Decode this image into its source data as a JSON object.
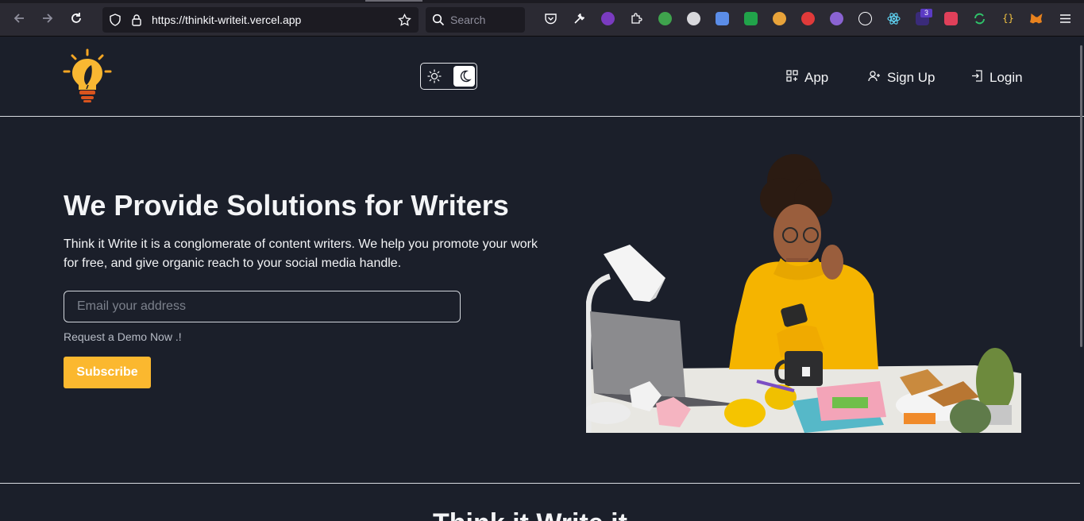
{
  "browser": {
    "url": "https://thinkit-writeit.vercel.app",
    "search_placeholder": "Search",
    "extension_badge": "3"
  },
  "header": {
    "nav": {
      "app_label": "App",
      "signup_label": "Sign Up",
      "login_label": "Login"
    }
  },
  "hero": {
    "title": "We Provide Solutions for Writers",
    "description": "Think it Write it is a conglomerate of content writers. We help you promote your work for free, and give organic reach to your social media handle.",
    "email_placeholder": "Email your address",
    "demo_text": "Request a Demo Now .!",
    "subscribe_label": "Subscribe"
  },
  "next_section": {
    "title": "Think it Write it"
  },
  "colors": {
    "background": "#1b1f2a",
    "accent": "#fbb82f",
    "text": "#f3f4f6"
  }
}
